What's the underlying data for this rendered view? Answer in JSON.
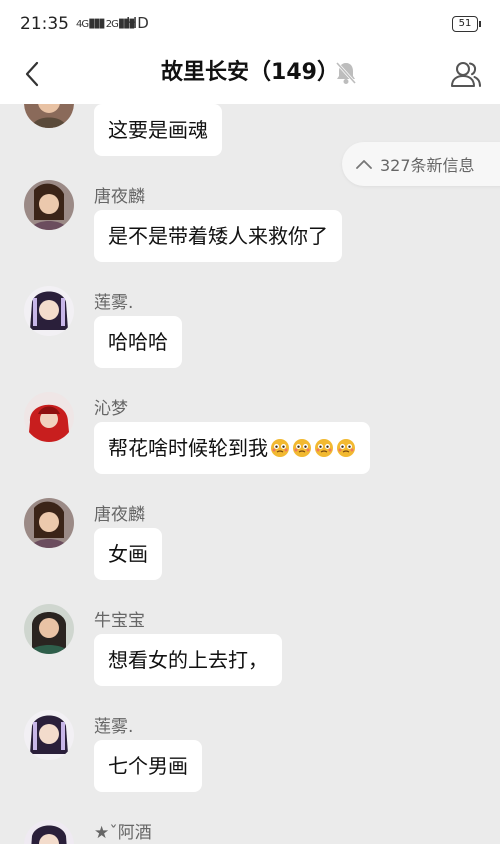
{
  "status_bar": {
    "time": "21:35",
    "sig1_label": "4G",
    "sig2_label": "2G",
    "hd": "HD",
    "battery": "51"
  },
  "nav": {
    "title": "故里长安（149）",
    "back_icon": "chevron-left-icon",
    "mute_icon": "bell-muted-icon",
    "members_icon": "group-members-icon"
  },
  "new_messages": {
    "label": "327条新信息"
  },
  "messages": [
    {
      "sender": "",
      "text": "这要是画魂"
    },
    {
      "sender": "唐夜麟",
      "text": "是不是带着矮人来救你了"
    },
    {
      "sender": "莲雾.",
      "text": "哈哈哈"
    },
    {
      "sender": "沁梦",
      "text": "帮花啥时候轮到我",
      "emoji_count": 4
    },
    {
      "sender": "唐夜麟",
      "text": "女画"
    },
    {
      "sender": "牛宝宝",
      "text": "想看女的上去打，"
    },
    {
      "sender": "莲雾.",
      "text": "七个男画"
    },
    {
      "sender": "★ˇ阿酒",
      "text": ""
    }
  ],
  "colors": {
    "background": "#ebebeb",
    "bubble": "#ffffff",
    "header": "#ffffff"
  }
}
